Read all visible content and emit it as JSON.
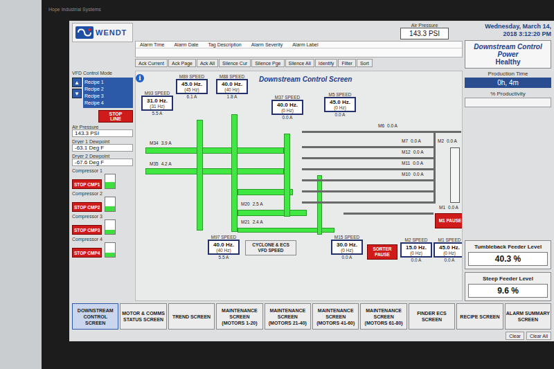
{
  "bezel": {
    "brand": "Hope Industrial Systems"
  },
  "logo": {
    "text": "WENDT"
  },
  "header": {
    "air_pressure": {
      "label": "Air Pressure",
      "value": "143.3 PSI"
    },
    "date": "Wednesday, March 14,",
    "time": "2018 3:12:20 PM",
    "power": {
      "title": "Downstream Control Power",
      "status": "Healthy"
    }
  },
  "alarms": {
    "columns": [
      "Alarm Time",
      "Alarm Date",
      "Tag Description",
      "Alarm Severity",
      "Alarm Label"
    ],
    "buttons": [
      "Ack Current",
      "Ack Page",
      "Ack All",
      "Silence Cur",
      "Silence Pge",
      "Silence All",
      "Identify",
      "Filter",
      "Sort"
    ]
  },
  "left_panel": {
    "mode_label": "VFD Control Mode",
    "arrows": [
      "▲",
      "▼"
    ],
    "recipes": [
      "Recipe 1",
      "Recipe 2",
      "Recipe 3",
      "Recipe 4"
    ],
    "stop_line": "STOP LINE",
    "air_pressure": {
      "label": "Air Pressure",
      "value": "143.3 PSI"
    },
    "dewpoints": [
      {
        "label": "Dryer 1 Dewpoint",
        "value": "-63.1 Deg F"
      },
      {
        "label": "Dryer 2 Dewpoint",
        "value": "-67.6 Deg F"
      }
    ],
    "compressors": [
      {
        "label": "Compressor 1",
        "stop": "STOP CMP1",
        "level": 0.45
      },
      {
        "label": "Compressor 2",
        "stop": "STOP CMP2",
        "level": 0.35
      },
      {
        "label": "Compressor 3",
        "stop": "STOP CMP3",
        "level": 0.3
      },
      {
        "label": "Compressor 4",
        "stop": "STOP CMP4",
        "level": 0.3
      }
    ]
  },
  "diagram": {
    "title": "Downstream Control Screen",
    "info": "i",
    "speeds": [
      {
        "label": "M93 SPEED",
        "value": "31.0 Hz.",
        "setpoint": "(31 Hz)",
        "current": "5.5 A"
      },
      {
        "label": "M89 SPEED",
        "value": "45.0 Hz.",
        "setpoint": "(45 Hz)",
        "current": "6.1 A"
      },
      {
        "label": "M88 SPEED",
        "value": "40.0 Hz.",
        "setpoint": "(40 Hz)",
        "current": "1.8 A"
      },
      {
        "label": "M37 SPEED",
        "value": "40.0 Hz.",
        "setpoint": "(0 Hz)",
        "current": "0.0 A"
      },
      {
        "label": "M5 SPEED",
        "value": "45.0 Hz.",
        "setpoint": "(0 Hz)",
        "current": "0.0 A"
      },
      {
        "label": "M97 SPEED",
        "value": "40.0 Hz.",
        "setpoint": "(40 Hz)",
        "current": "5.5 A"
      },
      {
        "label": "M15 SPEED",
        "value": "30.0 Hz.",
        "setpoint": "(0 Hz)",
        "current": "0.0 A"
      },
      {
        "label": "M2 SPEED",
        "value": "15.0 Hz.",
        "setpoint": "(0 Hz)",
        "current": "0.0 A"
      },
      {
        "label": "M1 SPEED",
        "value": "45.0 Hz.",
        "setpoint": "(0 Hz)",
        "current": "0.0 A"
      }
    ],
    "conveyors": [
      {
        "running": true
      },
      {
        "running": true
      },
      {
        "running": true
      },
      {
        "running": true
      },
      {
        "running": true
      },
      {
        "running": true
      },
      {
        "running": true
      },
      {
        "running": true
      },
      {
        "running": true
      },
      {
        "running": false
      },
      {
        "running": false
      },
      {
        "running": false
      },
      {
        "running": false
      },
      {
        "running": false
      },
      {
        "running": false
      },
      {
        "running": false
      },
      {
        "running": false
      },
      {
        "running": false
      }
    ],
    "motors": [
      {
        "label": "M34",
        "current": "3.9 A"
      },
      {
        "label": "M35",
        "current": "4.2 A"
      },
      {
        "label": "M20",
        "current": "2.5 A"
      },
      {
        "label": "M21",
        "current": "2.4 A"
      },
      {
        "label": "M6",
        "current": "0.0 A"
      },
      {
        "label": "M7",
        "current": "0.0 A"
      },
      {
        "label": "M12",
        "current": "0.0 A"
      },
      {
        "label": "M11",
        "current": "0.0 A"
      },
      {
        "label": "M10",
        "current": "0.0 A"
      },
      {
        "label": "M2",
        "current": "0.0 A"
      },
      {
        "label": "M1",
        "current": "0.0 A"
      }
    ],
    "buttons": [
      {
        "label": "CYCLONE & ECS VFD SPEED",
        "kind": "plain"
      },
      {
        "label": "SORTER PAUSE",
        "kind": "stop"
      },
      {
        "label": "M1 PAUSE",
        "kind": "stop"
      }
    ]
  },
  "right_panel": {
    "production_time": {
      "label": "Production Time",
      "value": "0h, 4m"
    },
    "productivity": {
      "label": "% Productivity"
    },
    "feeders": [
      {
        "label": "Tumbleback Feeder Level",
        "value": "40.3 %"
      },
      {
        "label": "Steep Feeder Level",
        "value": "9.6 %"
      }
    ]
  },
  "nav": [
    {
      "label": "DOWNSTREAM CONTROL SCREEN",
      "selected": true
    },
    {
      "label": "MOTOR & COMMS STATUS SCREEN",
      "selected": false
    },
    {
      "label": "TREND SCREEN",
      "selected": false
    },
    {
      "label": "MAINTENANCE SCREEN (MOTORS 1-20)",
      "selected": false
    },
    {
      "label": "MAINTENANCE SCREEN (MOTORS 21-40)",
      "selected": false
    },
    {
      "label": "MAINTENANCE SCREEN (MOTORS 41-60)",
      "selected": false
    },
    {
      "label": "MAINTENANCE SCREEN (MOTORS 61-80)",
      "selected": false
    },
    {
      "label": "FINDER ECS SCREEN",
      "selected": false
    },
    {
      "label": "RECIPE SCREEN",
      "selected": false
    },
    {
      "label": "ALARM SUMMARY SCREEN",
      "selected": false
    }
  ],
  "footer": [
    "Clear",
    "Clear All"
  ]
}
